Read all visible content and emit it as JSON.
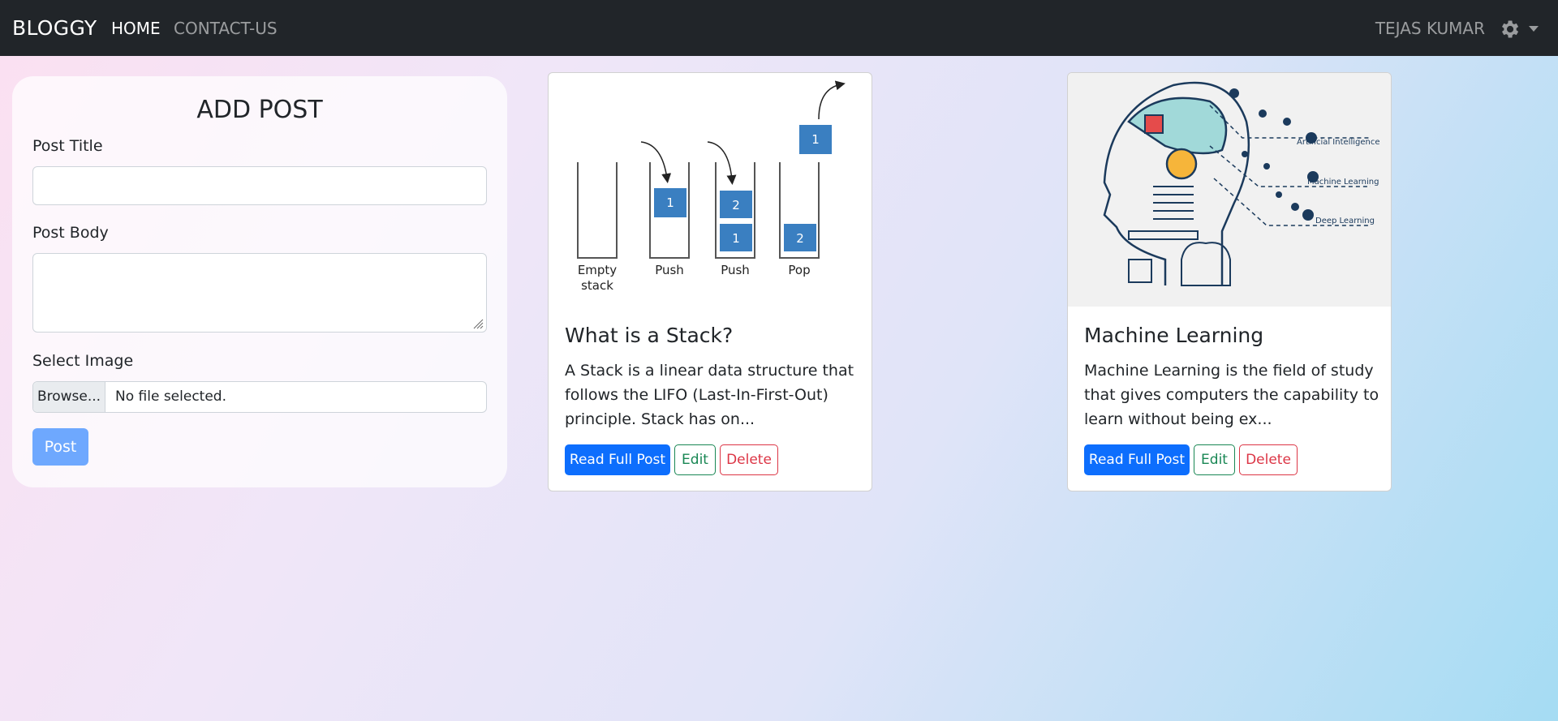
{
  "navbar": {
    "brand": "BLOGGY",
    "links": [
      {
        "label": "HOME",
        "active": true
      },
      {
        "label": "CONTACT-US",
        "active": false
      }
    ],
    "user": "TEJAS KUMAR",
    "settings_icon": "gear-icon"
  },
  "form": {
    "title": "ADD POST",
    "post_title_label": "Post Title",
    "post_title_value": "",
    "post_body_label": "Post Body",
    "post_body_value": "",
    "select_image_label": "Select Image",
    "browse_label": "Browse...",
    "file_status": "No file selected.",
    "submit_label": "Post"
  },
  "posts": [
    {
      "title": "What is a Stack?",
      "excerpt": "A Stack is a linear data structure that follows the LIFO (Last-In-First-Out) principle. Stack has on...",
      "read_label": "Read Full Post",
      "edit_label": "Edit",
      "delete_label": "Delete",
      "image": {
        "labels": [
          "Empty",
          "stack",
          "Push",
          "Push",
          "Pop"
        ],
        "blocks": [
          "1",
          "2",
          "1",
          "2",
          "1"
        ]
      }
    },
    {
      "title": "Machine Learning",
      "excerpt": "Machine Learning is the field of study that gives computers the capability to learn without being ex...",
      "read_label": "Read Full Post",
      "edit_label": "Edit",
      "delete_label": "Delete",
      "image": {
        "labels": [
          "Artificial Intelligence",
          "Machine Learning",
          "Deep Learning"
        ]
      }
    }
  ],
  "colors": {
    "navbar": "#212529",
    "primary": "#0d6efd",
    "success": "#198754",
    "danger": "#dc3545",
    "stack_block": "#3a7fc1",
    "ml_line": "#1b3a5c"
  }
}
